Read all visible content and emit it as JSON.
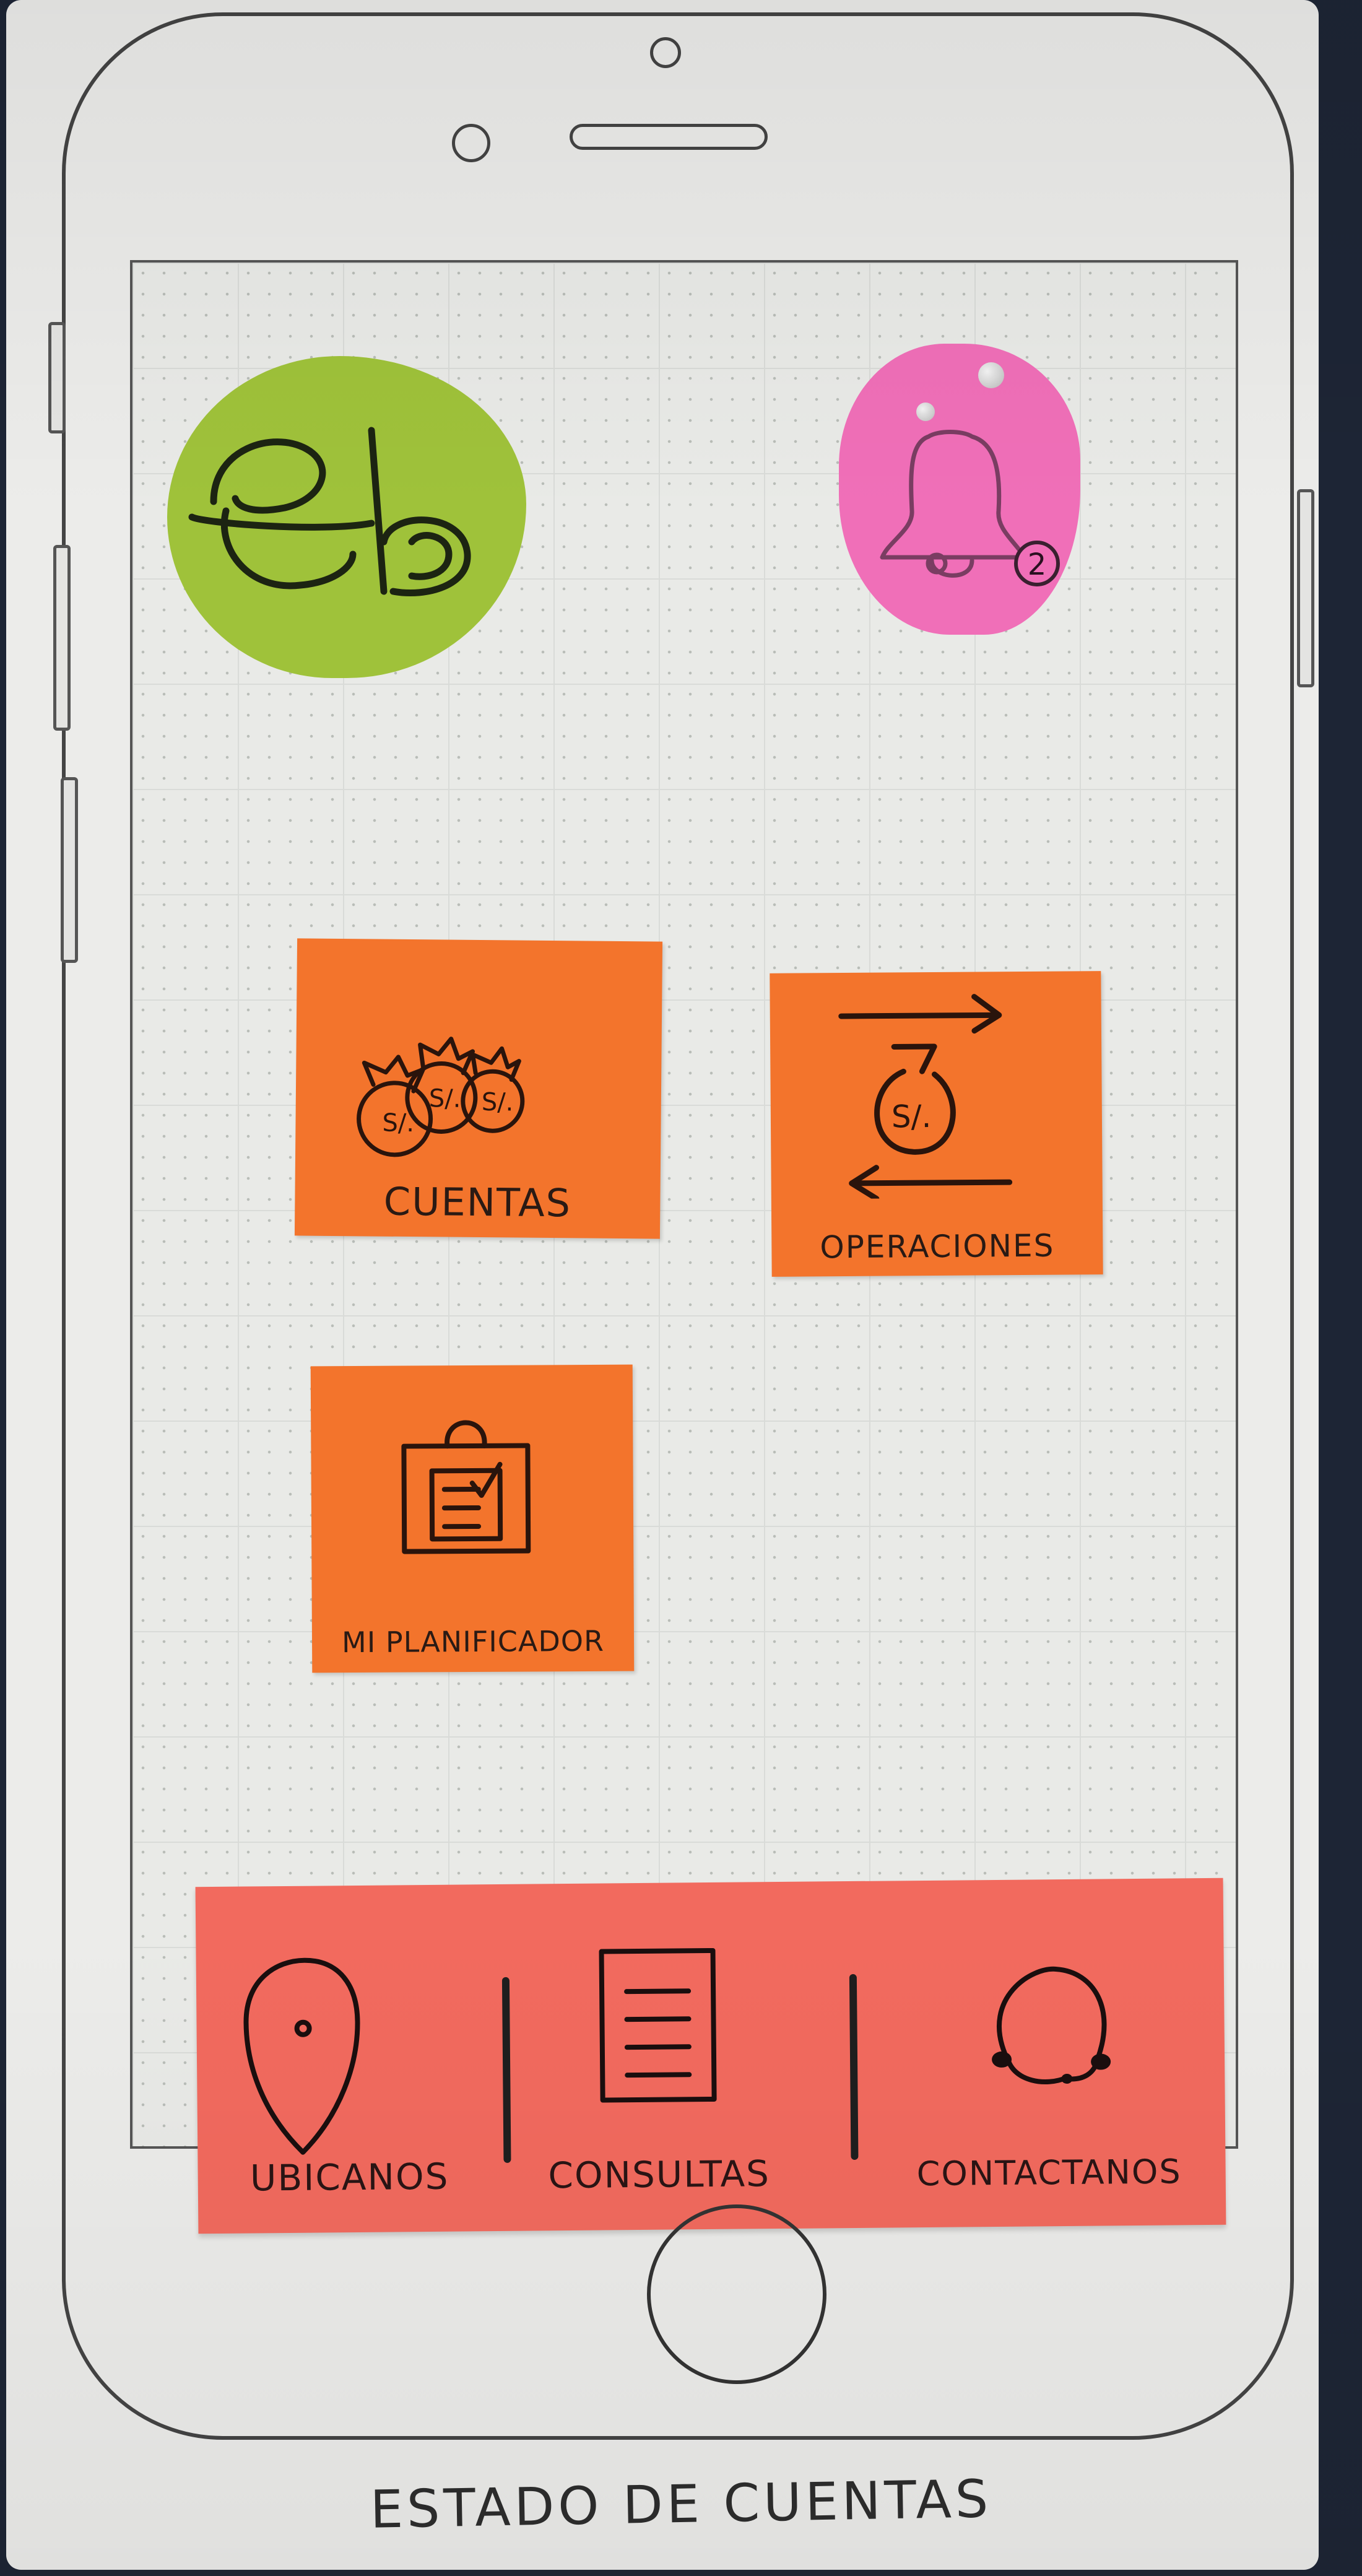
{
  "header": {
    "logo_icon": "eb-logo-icon",
    "notifications_icon": "bell-icon",
    "notifications_count": "2"
  },
  "menu": {
    "tiles": [
      {
        "label": "CUENTAS",
        "icon": "money-bags-icon"
      },
      {
        "label": "OPERACIONES",
        "icon": "transfer-icon"
      },
      {
        "label": "MI PLANIFICADOR",
        "icon": "planner-bag-icon"
      }
    ]
  },
  "tab_bar": {
    "items": [
      {
        "label": "UBICANOS",
        "icon": "location-pin-icon"
      },
      {
        "label": "CONSULTAS",
        "icon": "document-icon"
      },
      {
        "label": "CONTACTANOS",
        "icon": "headset-icon"
      }
    ]
  },
  "caption": "ESTADO DE CUENTAS",
  "colors": {
    "tile": "#f3742c",
    "tab_bar": "#f26a5e",
    "logo": "#9fc23a",
    "bell": "#f06fb8"
  }
}
